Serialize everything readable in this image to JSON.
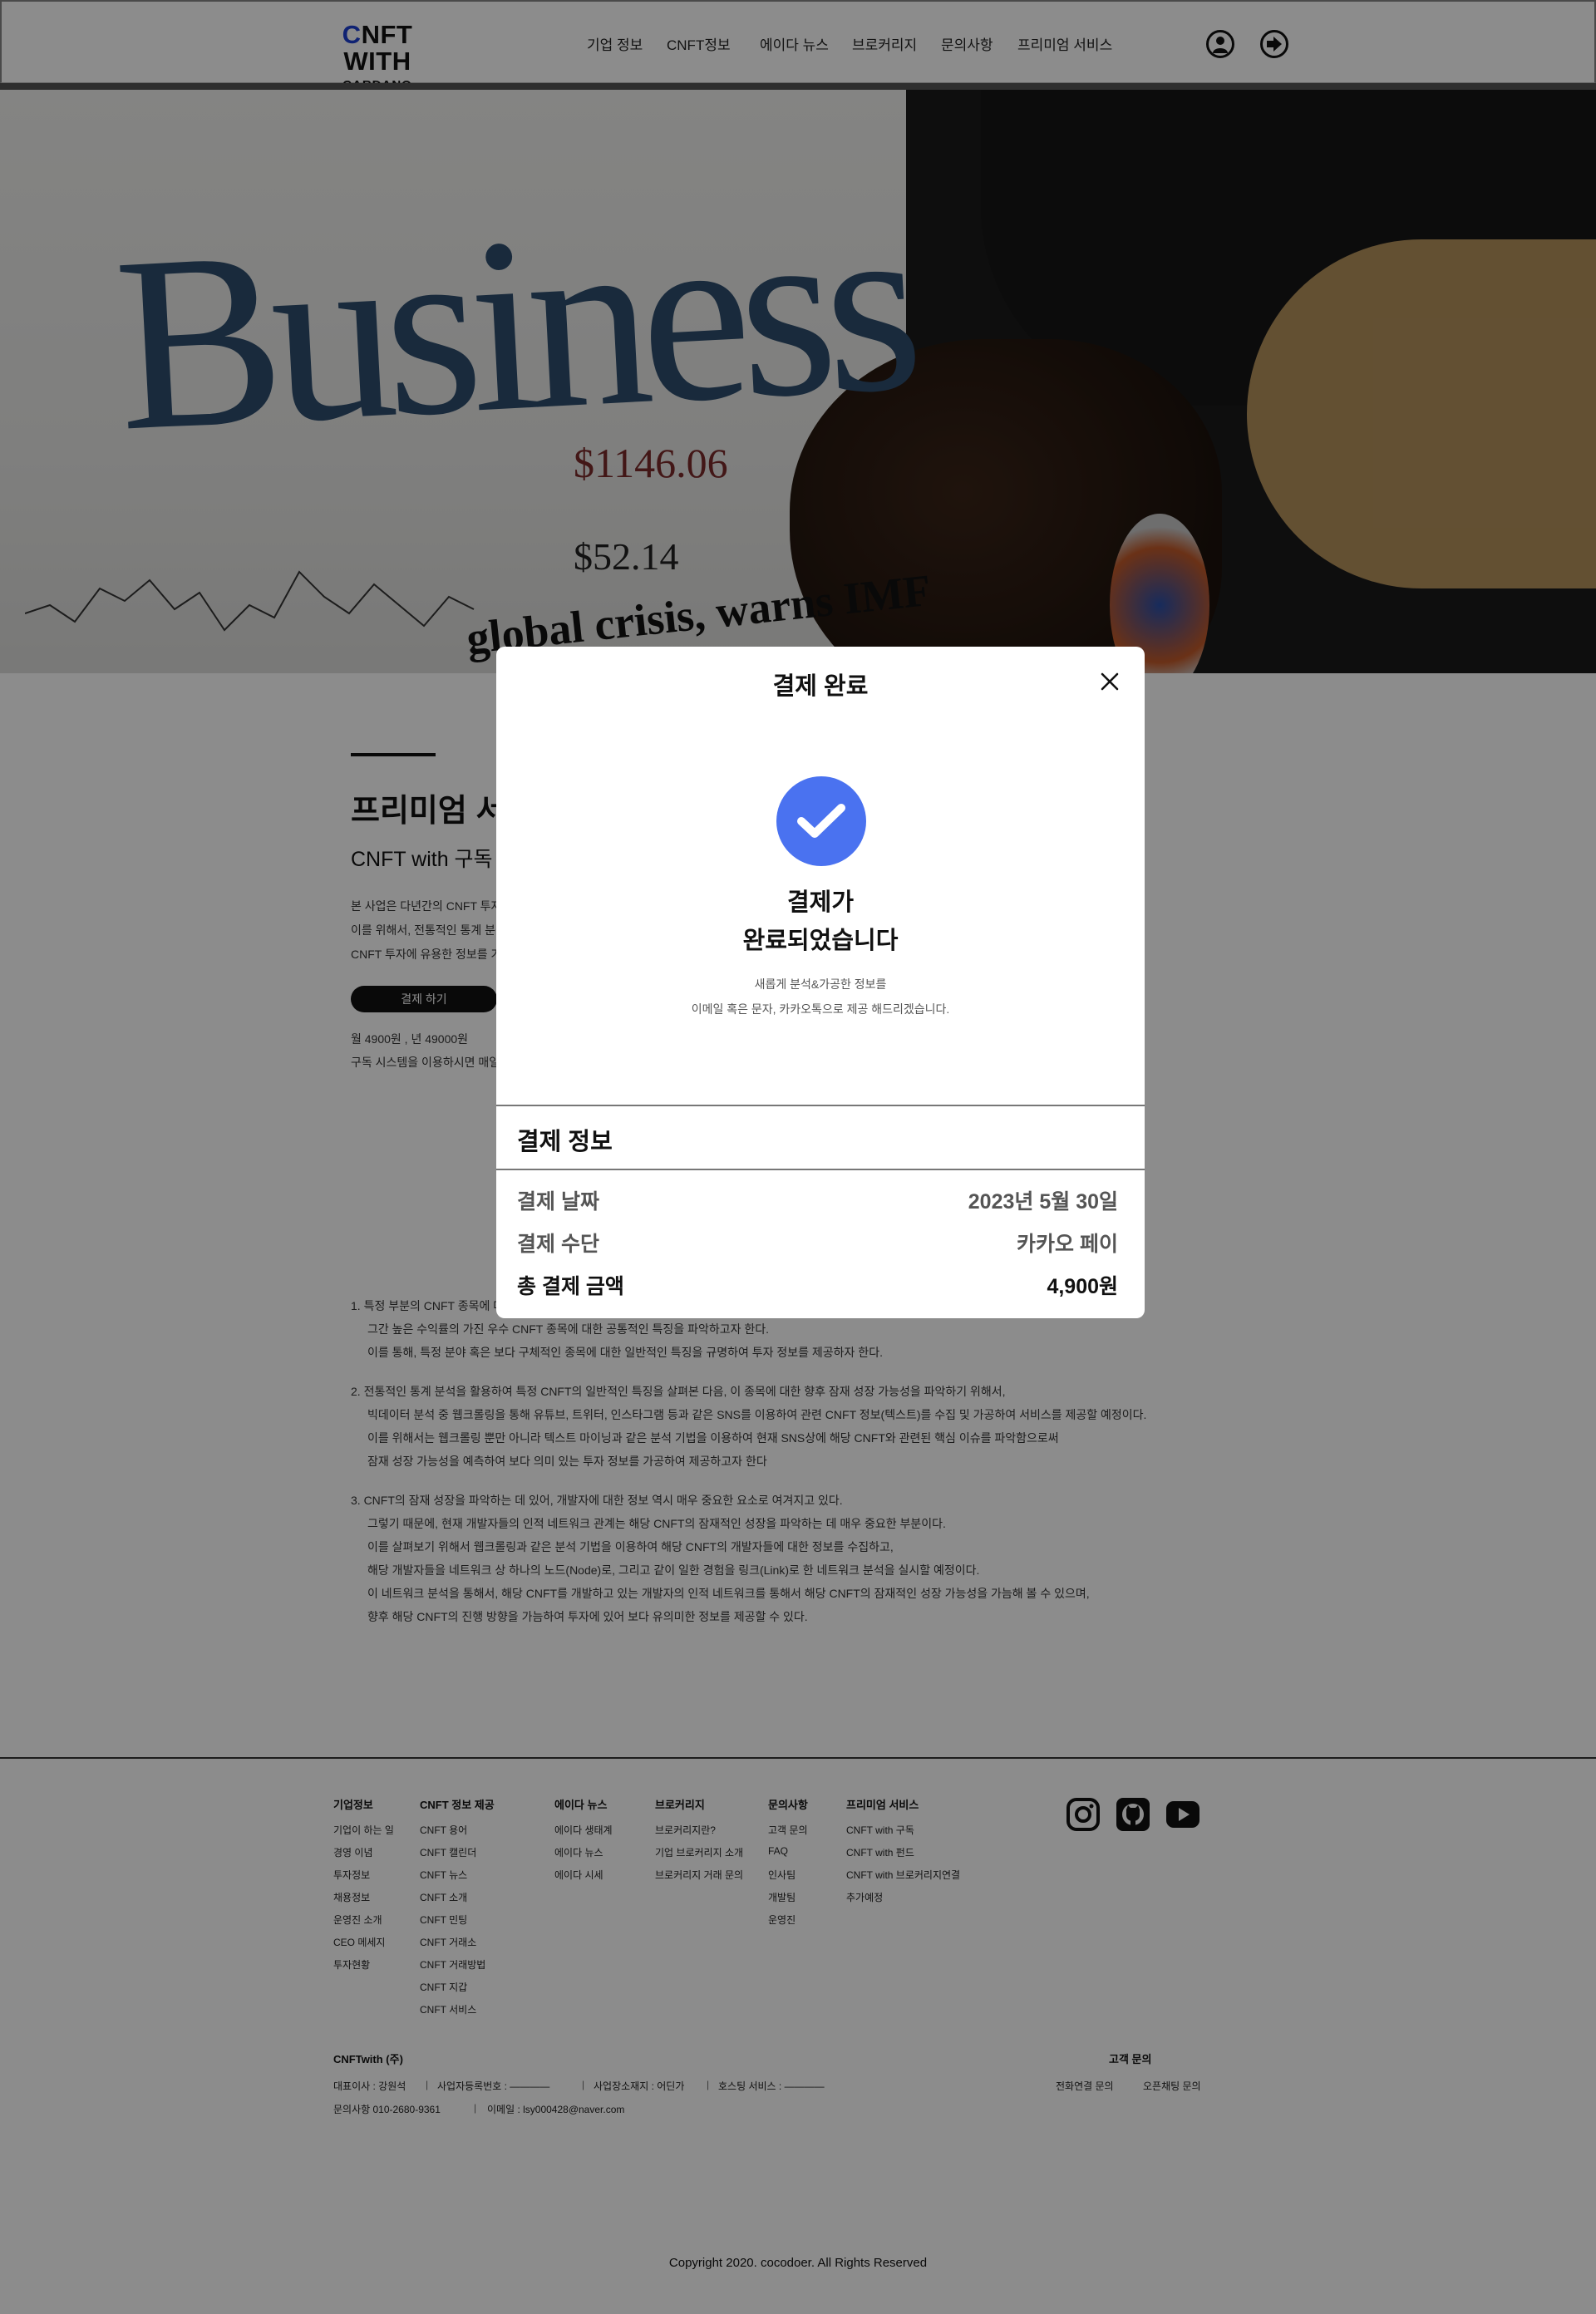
{
  "header": {
    "logo_main": "CNFT WITH",
    "logo_sub": "CARDANO",
    "nav": [
      "기업 정보",
      "CNFT정보",
      "에이다 뉴스",
      "브로커리지",
      "문의사항",
      "프리미엄 서비스"
    ]
  },
  "hero": {
    "word": "Business",
    "headline": "global crisis, warns IMF",
    "price1": "$1146.06",
    "price2": "$52.14"
  },
  "premium": {
    "title": "프리미엄 서비스",
    "subtitle": "CNFT with 구독 서비스",
    "desc": [
      "본 사업은 다년간의 CNFT 투자 경험을 바탕으로 빅데이터 분석을 통한 CNFT 투자 정보를 제공하는 것을 목표로 합니다.",
      "이를 위해서, 전통적인 통계 분석과 웹크롤링 등 다양한 분석 기법을 활용하여",
      "CNFT 투자에 유용한 정보를 가공하여 제공하고자 합니다."
    ],
    "pay_button": "결제 하기",
    "price_line": "월 4900원 , 년 49000원",
    "price_note": "구독 시스템을 이용하시면 매일 새로운 분석 정보를 받아보실 수 있습니다."
  },
  "info": {
    "lines": [
      "1.  특정 부분의 CNFT 종목에 대한 투자 성과를 분석하여,",
      "그간 높은 수익률의 가진 우수 CNFT 종목에 대한 공통적인 특징을 파악하고자 한다.",
      "이를 통해, 특정 분야 혹은 보다 구체적인 종목에 대한 일반적인 특징을 규명하여 투자 정보를 제공하자 한다.",
      "2.  전통적인 통계 분석을 활용하여 특정 CNFT의 일반적인 특징을 살펴본 다음, 이 종목에 대한 향후 잠재 성장 가능성을 파악하기 위해서,",
      "빅데이터 분석 중 웹크롤링을 통해 유튜브, 트위터, 인스타그램 등과 같은 SNS를 이용하여 관련 CNFT 정보(텍스트)를 수집 및 가공하여 서비스를 제공할 예정이다.",
      "이를 위해서는 웹크롤링 뿐만 아니라 텍스트 마이닝과 같은 분석 기법을 이용하여 현재 SNS상에 해당 CNFT와 관련된 핵심 이슈를 파악함으로써",
      "잠재 성장 가능성을 예측하여 보다 의미 있는 투자 정보를 가공하여 제공하고자 한다",
      "3.  CNFT의 잠재 성장을 파악하는 데 있어, 개발자에 대한 정보 역시 매우 중요한 요소로 여겨지고 있다.",
      "그렇기 때문에, 현재 개발자들의 인적 네트워크 관계는 해당 CNFT의 잠재적인 성장을 파악하는 데 매우 중요한 부분이다.",
      "이를 살펴보기 위해서 웹크롤링과 같은 분석 기법을 이용하여 해당 CNFT의 개발자들에 대한 정보를 수집하고,",
      "해당 개발자들을 네트워크 상 하나의 노드(Node)로, 그리고 같이 일한 경험을 링크(Link)로 한 네트워크 분석을 실시할 예정이다.",
      "이 네트워크 분석을 통해서, 해당 CNFT를 개발하고 있는 개발자의 인적 네트워크를 통해서 해당 CNFT의 잠재적인 성장 가능성을 가늠해 볼 수 있으며,",
      "향후 해당 CNFT의 진행 방향을 가늠하여 투자에 있어 보다 유의미한 정보를 제공할 수 있다."
    ]
  },
  "footer": {
    "columns": [
      {
        "title": "기업정보",
        "items": [
          "기업이 하는 일",
          "경영 이념",
          "투자정보",
          "채용정보",
          "운영진 소개",
          "CEO 메세지",
          "투자현황"
        ]
      },
      {
        "title": "CNFT 정보 제공",
        "items": [
          "CNFT 용어",
          "CNFT 캘린더",
          "CNFT 뉴스",
          "CNFT 소개",
          "CNFT 민팅",
          "CNFT 거래소",
          "CNFT 거래방법",
          "CNFT 지갑",
          "CNFT 서비스"
        ]
      },
      {
        "title": "에이다 뉴스",
        "items": [
          "에이다 생태계",
          "에이다 뉴스",
          "에이다 시세"
        ]
      },
      {
        "title": "브로커리지",
        "items": [
          "브로커리지란?",
          "기업 브로커리지 소개",
          "브로커리지 거래 문의"
        ]
      },
      {
        "title": "문의사항",
        "items": [
          "고객 문의",
          "FAQ",
          "인사팀",
          "개발팀",
          "운영진"
        ]
      },
      {
        "title": "프리미엄 서비스",
        "items": [
          "CNFT with 구독",
          "CNFT with 펀드",
          "CNFT with 브로커리지연결",
          "추가예정"
        ]
      }
    ],
    "company": "CNFTwith (주)",
    "ceo": "대표이사 : 강원석",
    "biz_no": "사업자등록번호 : ————",
    "address": "사업장소재지 : 어딘가",
    "hosting": "호스팅 서비스 : ————",
    "phone": "문의사항  010-2680-9361",
    "email": "이메일 : lsy000428@naver.com",
    "support_title": "고객 문의",
    "support_phone": "전화연결 문의",
    "support_chat": "오픈채팅 문의",
    "copyright": "Copyright 2020. cocodoer. All Rights Reserved"
  },
  "modal": {
    "title": "결제 완료",
    "done_line1": "결제가",
    "done_line2": "완료되었습니다",
    "note_line1": "새롭게 분석&가공한 정보를",
    "note_line2": "이메일 혹은 문자, 카카오톡으로 제공 해드리겠습니다.",
    "info_title": "결제 정보",
    "rows": [
      {
        "label": "결제 날짜",
        "value": "2023년 5월 30일"
      },
      {
        "label": "결제 수단",
        "value": "카카오 페이"
      },
      {
        "label": "총 결제 금액",
        "value": "4,900원"
      }
    ],
    "accent": "#4a72f0"
  }
}
